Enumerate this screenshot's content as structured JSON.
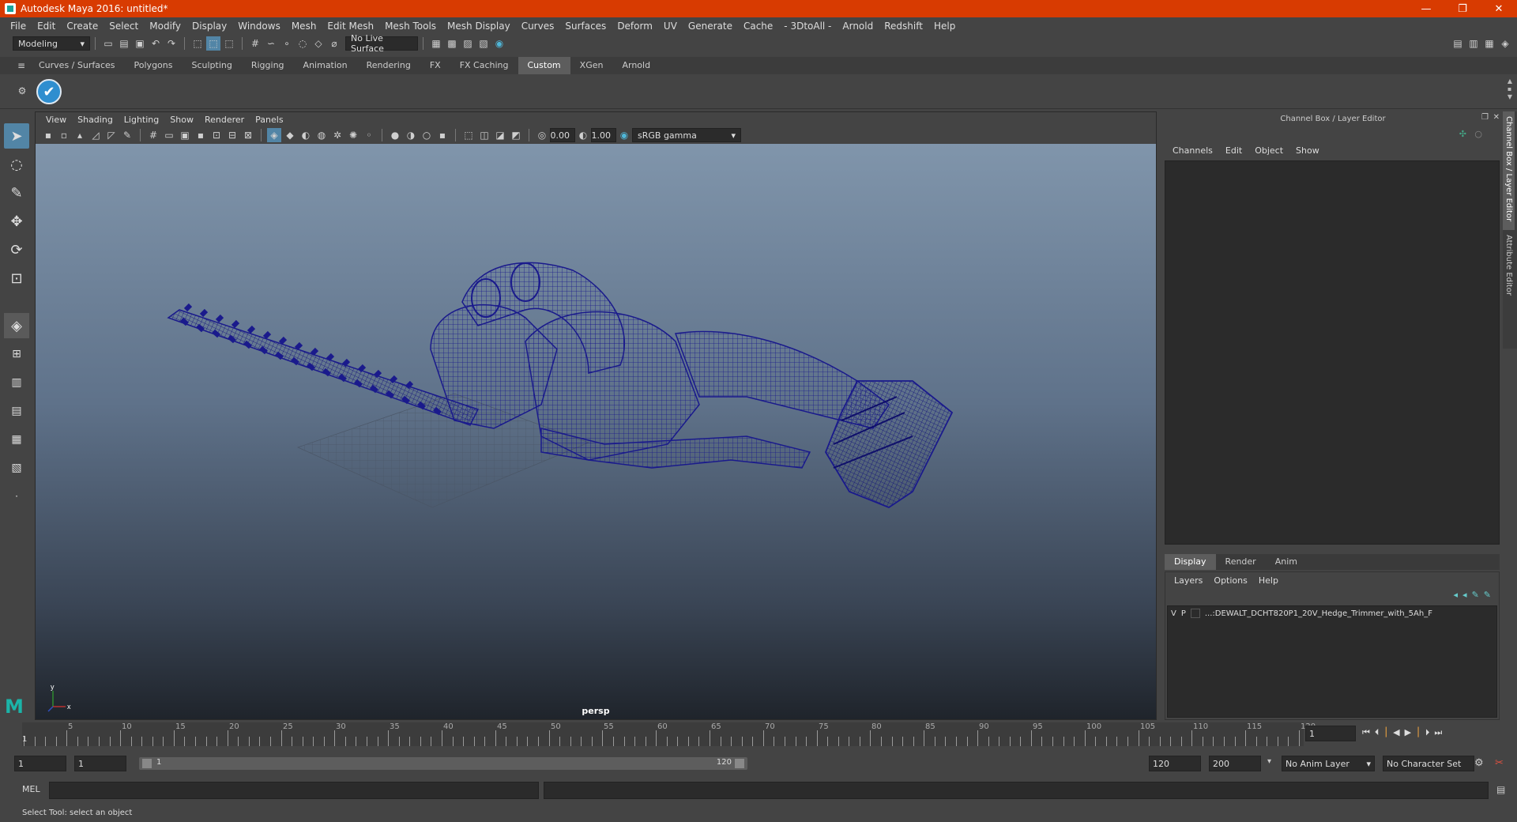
{
  "title_bar": {
    "title": "Autodesk Maya 2016: untitled*",
    "minimize": "—",
    "restore": "❐",
    "close": "✕"
  },
  "menu": [
    "File",
    "Edit",
    "Create",
    "Select",
    "Modify",
    "Display",
    "Windows",
    "Mesh",
    "Edit Mesh",
    "Mesh Tools",
    "Mesh Display",
    "Curves",
    "Surfaces",
    "Deform",
    "UV",
    "Generate",
    "Cache",
    "- 3DtoAll -",
    "Arnold",
    "Redshift",
    "Help"
  ],
  "status_line": {
    "mode": "Modeling",
    "live_surface": "No Live Surface"
  },
  "shelf_tabs": [
    "Curves / Surfaces",
    "Polygons",
    "Sculpting",
    "Rigging",
    "Animation",
    "Rendering",
    "FX",
    "FX Caching",
    "Custom",
    "XGen",
    "Arnold"
  ],
  "shelf_active": "Custom",
  "viewport": {
    "menu": [
      "View",
      "Shading",
      "Lighting",
      "Show",
      "Renderer",
      "Panels"
    ],
    "exposure": "0.00",
    "gamma": "1.00",
    "color_space": "sRGB gamma",
    "camera_label": "persp",
    "axis_y": "y",
    "axis_x": "x"
  },
  "channel_box": {
    "title": "Channel Box / Layer Editor",
    "menu": [
      "Channels",
      "Edit",
      "Object",
      "Show"
    ],
    "layer_tabs": [
      "Display",
      "Render",
      "Anim"
    ],
    "layer_menu": [
      "Layers",
      "Options",
      "Help"
    ],
    "layer_row": {
      "v": "V",
      "p": "P",
      "name": "...:DEWALT_DCHT820P1_20V_Hedge_Trimmer_with_5Ah_F"
    }
  },
  "side_tabs": [
    "Channel Box / Layer Editor",
    "Attribute Editor"
  ],
  "timeline": {
    "ticks": [
      "5",
      "10",
      "15",
      "20",
      "25",
      "30",
      "35",
      "40",
      "45",
      "50",
      "55",
      "60",
      "65",
      "70",
      "75",
      "80",
      "85",
      "90",
      "95",
      "100",
      "105",
      "110",
      "115",
      "120"
    ],
    "start_marker": "1",
    "current_frame": "1"
  },
  "range": {
    "start": "1",
    "playback_start": "1",
    "slider_start": "1",
    "slider_end": "120",
    "playback_end": "120",
    "end": "200",
    "anim_layer": "No Anim Layer",
    "character_set": "No Character Set"
  },
  "command": {
    "label": "MEL"
  },
  "help_line": "Select Tool: select an object"
}
